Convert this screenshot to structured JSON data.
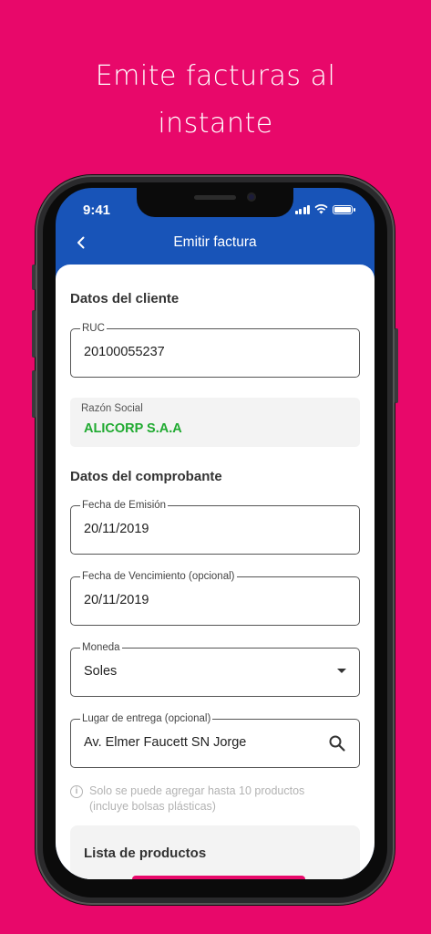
{
  "headline": {
    "line1": "Emite facturas al",
    "line2": "instante"
  },
  "status_bar": {
    "time": "9:41"
  },
  "app_bar": {
    "title": "Emitir factura",
    "back_icon": "chevron-left-icon"
  },
  "client_section": {
    "title": "Datos del cliente",
    "ruc": {
      "label": "RUC",
      "value": "20100055237"
    },
    "razon_social": {
      "label": "Razón Social",
      "value": "ALICORP S.A.A"
    }
  },
  "voucher_section": {
    "title": "Datos del comprobante",
    "fecha_emision": {
      "label": "Fecha de Emisión",
      "value": "20/11/2019"
    },
    "fecha_vencimiento": {
      "label": "Fecha de Vencimiento (opcional)",
      "value": "20/11/2019"
    },
    "moneda": {
      "label": "Moneda",
      "value": "Soles"
    },
    "lugar_entrega": {
      "label": "Lugar de entrega (opcional)",
      "value": "Av. Elmer Faucett SN Jorge"
    }
  },
  "info_note": {
    "line1": "Solo se puede agregar hasta 10 productos",
    "line2": "(incluye bolsas plásticas)"
  },
  "products": {
    "title": "Lista de productos"
  },
  "colors": {
    "background": "#E8086A",
    "app_bar": "#1854B8",
    "razon_social_text": "#1FAA30"
  }
}
